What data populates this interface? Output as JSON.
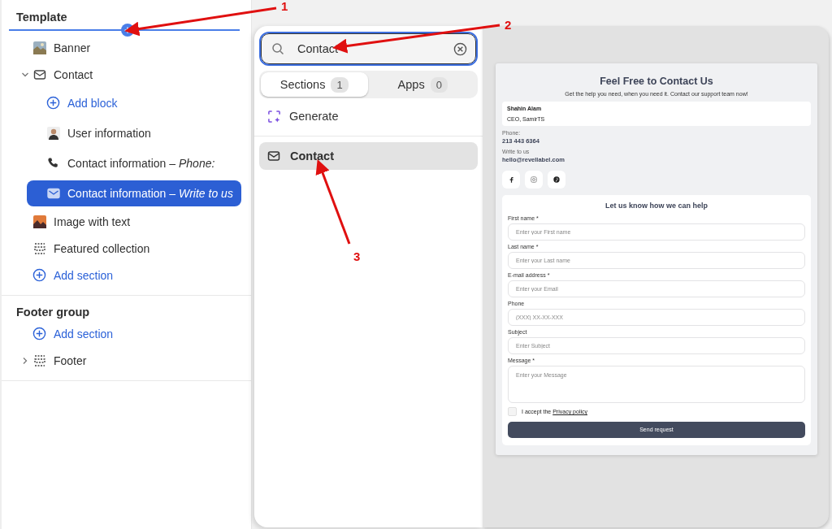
{
  "sidebar": {
    "groups": [
      {
        "title": "Template",
        "items": [
          {
            "kind": "section",
            "label": "Banner",
            "selected": false
          },
          {
            "kind": "section",
            "label": "Contact",
            "selected": false,
            "expanded": true,
            "children": [
              {
                "kind": "add",
                "label": "Add block",
                "selected": false
              },
              {
                "kind": "block",
                "label": "User information",
                "selected": false
              },
              {
                "kind": "block",
                "label": "Contact information *– Phone:*",
                "selected": false
              },
              {
                "kind": "block",
                "label": "Contact information *– Write to us*",
                "selected": true
              }
            ]
          },
          {
            "kind": "section",
            "label": "Image with text",
            "selected": false
          },
          {
            "kind": "section",
            "label": "Featured collection",
            "selected": false
          },
          {
            "kind": "add",
            "label": "Add section",
            "selected": false
          }
        ]
      },
      {
        "title": "Footer group",
        "items": [
          {
            "kind": "add",
            "label": "Add section",
            "selected": false
          },
          {
            "kind": "section",
            "label": "Footer",
            "selected": false,
            "expanded": false
          }
        ]
      }
    ]
  },
  "picker": {
    "search": {
      "value": "Contact"
    },
    "tabs": [
      {
        "label": "Sections",
        "count": "1",
        "selected": true
      },
      {
        "label": "Apps",
        "count": "0",
        "selected": false
      }
    ],
    "generate": "Generate",
    "results": [
      {
        "label": "Contact",
        "selected": true
      }
    ]
  },
  "preview": {
    "title": "Feel Free to Contact Us",
    "subtitle": "Get the help you need, when you need it. Contact our support team now!",
    "profile": {
      "name": "Shahin Alam",
      "role": "CEO, SamirTS"
    },
    "contacts": [
      {
        "label": "Phone:",
        "value": "213 443 6364"
      },
      {
        "label": "Write to us",
        "value": "hello@revellabel.com"
      }
    ],
    "form": {
      "title": "Let us know how we can help",
      "fields": [
        {
          "kind": "input",
          "label": "First name *",
          "placeholder": "Enter your First name"
        },
        {
          "kind": "input",
          "label": "Last name *",
          "placeholder": "Enter your Last name"
        },
        {
          "kind": "input",
          "label": "E-mail address *",
          "placeholder": "Enter your Email"
        },
        {
          "kind": "input",
          "label": "Phone",
          "placeholder": "(XXX) XX-XX-XXX"
        },
        {
          "kind": "input",
          "label": "Subject",
          "placeholder": "Enter Subject"
        },
        {
          "kind": "textarea",
          "label": "Message *",
          "placeholder": "Enter your Message"
        }
      ],
      "consent": {
        "checked": false,
        "text": "I accept the",
        "link": "Privacy policy"
      },
      "submit": "Send request"
    }
  },
  "annotations": [
    {
      "label": "1"
    },
    {
      "label": "2"
    },
    {
      "label": "3"
    }
  ]
}
